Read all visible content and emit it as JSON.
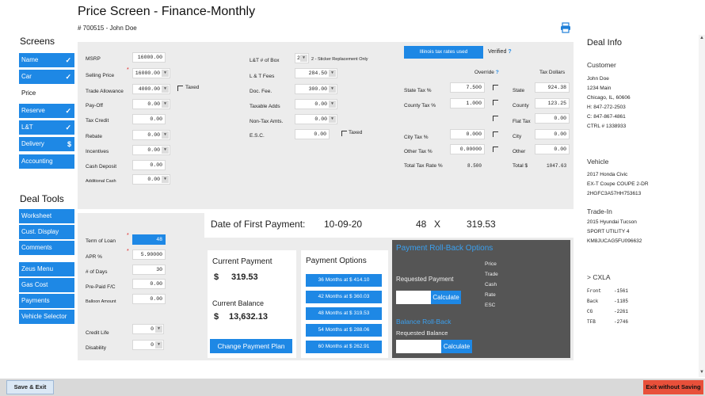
{
  "header": {
    "title": "Price Screen - Finance-Monthly",
    "subtitle": "# 700515 - John Doe"
  },
  "screens": {
    "title": "Screens",
    "items": [
      {
        "label": "Name",
        "mark": "✓"
      },
      {
        "label": "Car",
        "mark": "✓"
      },
      {
        "label": "Price",
        "mark": ""
      },
      {
        "label": "Reserve",
        "mark": "✓"
      },
      {
        "label": "L&T",
        "mark": "✓"
      },
      {
        "label": "Delivery",
        "mark": "$"
      },
      {
        "label": "Accounting",
        "mark": ""
      }
    ]
  },
  "tools": {
    "title": "Deal Tools",
    "items": [
      "Worksheet",
      "Cust. Display",
      "Comments",
      "Zeus Menu",
      "Gas Cost",
      "Payments",
      "Vehicle Selector"
    ]
  },
  "price": {
    "msrp_label": "MSRP",
    "msrp": "16000.00",
    "selling_label": "Selling Price",
    "selling": "16000.00",
    "trade_label": "Trade Allowance",
    "trade": "4000.00",
    "taxed_label": "Taxed",
    "payoff_label": "Pay-Off",
    "payoff": "0.00",
    "taxcredit_label": "Tax Credit",
    "taxcredit": "0.00",
    "rebate_label": "Rebate",
    "rebate": "0.00",
    "incentives_label": "Incentives",
    "incentives": "0.00",
    "cashdep_label": "Cash Deposit",
    "cashdep": "0.00",
    "addcash_label": "Additional Cash",
    "addcash": "0.00"
  },
  "fees": {
    "lt_box_label": "L&T # of Box",
    "lt_box": "2",
    "lt_box_desc": "2 - Sticker Replacement Only",
    "ltfees_label": "L & T Fees",
    "ltfees": "284.50",
    "docfee_label": "Doc. Fee.",
    "docfee": "300.00",
    "taxadds_label": "Taxable Adds",
    "taxadds": "0.00",
    "nontax_label": "Non-Tax Amts.",
    "nontax": "0.00",
    "esc_label": "E.S.C.",
    "esc": "0.00",
    "esc_taxed": "Taxed"
  },
  "tax": {
    "button": "Illinois tax rates used",
    "verified": "Verified",
    "q": "?",
    "override": "Override",
    "taxdollars": "Tax Dollars",
    "state_label": "State Tax %",
    "state_rate": "7.500",
    "state_name": "State",
    "state_amt": "924.38",
    "county_label": "County Tax %",
    "county_rate": "1.000",
    "county_name": "County",
    "county_amt": "123.25",
    "flat_name": "Flat Tax",
    "flat_amt": "0.00",
    "city_label": "City Tax %",
    "city_rate": "0.000",
    "city_name": "City",
    "city_amt": "0.00",
    "other_label": "Other Tax %",
    "other_rate": "0.00000",
    "other_name": "Other",
    "other_amt": "0.00",
    "total_label": "Total Tax Rate %",
    "total_rate": "8.500",
    "total_name": "Total $",
    "total_amt": "1047.63"
  },
  "loan": {
    "term_label": "Term of Loan",
    "term": "48",
    "apr_label": "APR %",
    "apr": "5.90000",
    "days_label": "# of Days",
    "days": "30",
    "prepaid_label": "Pre-Paid F/C",
    "prepaid": "0.00",
    "balloon_label": "Balloon Amount",
    "balloon": "0.00",
    "life_label": "Credit Life",
    "life": "0",
    "disab_label": "Disability",
    "disab": "0"
  },
  "summary": {
    "first_pay_label": "Date of First Payment:",
    "first_pay": "10-09-20",
    "term": "48",
    "x": "X",
    "payment": "319.53"
  },
  "current": {
    "title": "Current Payment",
    "dollar": "$",
    "payment": "319.53",
    "bal_label": "Current Balance",
    "balance": "13,632.13",
    "change_btn": "Change Payment Plan"
  },
  "options": {
    "title": "Payment Options",
    "items": [
      "36 Months at $ 414.10",
      "42 Months at $ 360.03",
      "48 Months at $ 319.53",
      "54 Months at $ 288.06",
      "60 Months at $ 262.91"
    ]
  },
  "rollback": {
    "title": "Payment Roll-Back Options",
    "req_label": "Requested Payment",
    "calc": "Calculate",
    "opts": [
      "Price",
      "Trade",
      "Cash",
      "Rate",
      "ESC"
    ],
    "bal_title": "Balance Roll-Back",
    "bal_req": "Requested Balance",
    "calc2": "Calculate"
  },
  "deal": {
    "title": "Deal Info",
    "customer_h": "Customer",
    "customer": [
      "John Doe",
      "1234 Main",
      "Chicago, IL, 60606",
      "H: 847-272-2503",
      "C: 847-867-4861",
      "CTRL # 1338933"
    ],
    "vehicle_h": "Vehicle",
    "vehicle": [
      "2017 Honda Civic",
      "EX-T Coupe COUPE 2-DR",
      "2HGFC3A57HH753613"
    ],
    "trade_h": "Trade-In",
    "trade": [
      "2015 Hyundai Tucson",
      "SPORT UTILITY 4",
      "KM8JUCAG5FU096632"
    ],
    "cxla_h": "> CXLA",
    "cxla": [
      {
        "k": "Front",
        "v": "-1561"
      },
      {
        "k": "Back",
        "v": "-1185"
      },
      {
        "k": "CG",
        "v": "-2261"
      },
      {
        "k": "TFB",
        "v": "-2746"
      }
    ]
  },
  "footer": {
    "save": "Save & Exit",
    "exit": "Exit without Saving"
  },
  "colors": {
    "accent": "#1e88e5",
    "panel": "#ececec",
    "dark": "#555555",
    "exit": "#e8503a"
  }
}
